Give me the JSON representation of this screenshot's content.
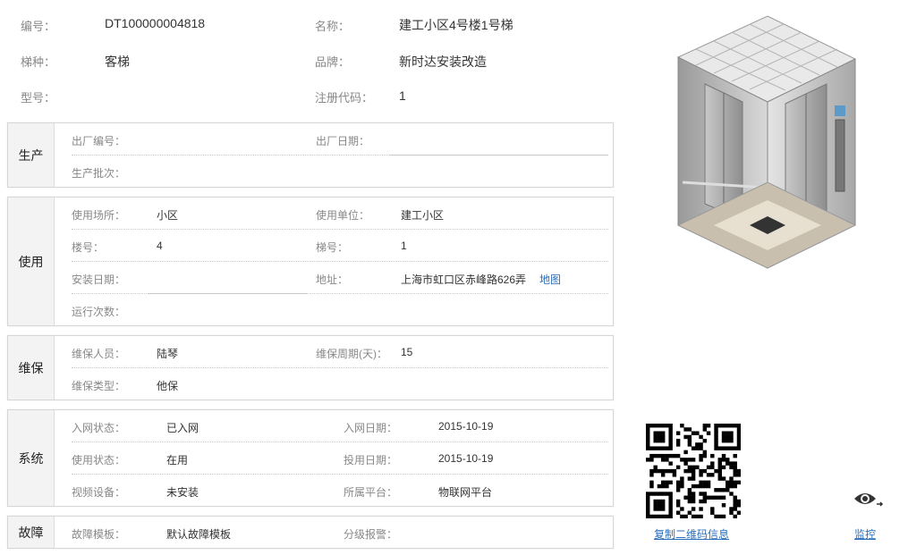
{
  "info": {
    "code_label": "编号：",
    "code_value": "DT100000004818",
    "name_label": "名称：",
    "name_value": "建工小区4号楼1号梯",
    "type_label": "梯种：",
    "type_value": "客梯",
    "brand_label": "品牌：",
    "brand_value": "新时达安装改造",
    "model_label": "型号：",
    "model_value": "",
    "reg_label": "注册代码：",
    "reg_value": "1"
  },
  "production": {
    "title": "生产",
    "factory_no_label": "出厂编号：",
    "factory_no_value": "",
    "factory_date_label": "出厂日期：",
    "factory_date_value": "",
    "batch_label": "生产批次：",
    "batch_value": ""
  },
  "usage": {
    "title": "使用",
    "place_label": "使用场所：",
    "place_value": "小区",
    "unit_label": "使用单位：",
    "unit_value": "建工小区",
    "building_label": "楼号：",
    "building_value": "4",
    "elevator_no_label": "梯号：",
    "elevator_no_value": "1",
    "install_date_label": "安装日期：",
    "install_date_value": "",
    "address_label": "地址：",
    "address_value": "上海市虹口区赤峰路626弄",
    "map_link": "地图",
    "run_count_label": "运行次数：",
    "run_count_value": ""
  },
  "maintenance": {
    "title": "维保",
    "staff_label": "维保人员：",
    "staff_value": "陆琴",
    "period_label": "维保周期(天)：",
    "period_value": "15",
    "mtype_label": "维保类型：",
    "mtype_value": "他保"
  },
  "system": {
    "title": "系统",
    "net_status_label": "入网状态：",
    "net_status_value": "已入网",
    "net_date_label": "入网日期：",
    "net_date_value": "2015-10-19",
    "use_status_label": "使用状态：",
    "use_status_value": "在用",
    "use_date_label": "投用日期：",
    "use_date_value": "2015-10-19",
    "video_label": "视频设备：",
    "video_value": "未安装",
    "platform_label": "所属平台：",
    "platform_value": "物联网平台"
  },
  "fault": {
    "title": "故障",
    "template_label": "故障模板：",
    "template_value": "默认故障模板",
    "alarm_label": "分级报警：",
    "alarm_value": ""
  },
  "actions": {
    "copy_qr": "复制二维码信息",
    "monitor": "监控"
  },
  "icons": {
    "monitor": "eye-icon",
    "qr": "qr-code"
  },
  "colors": {
    "link": "#2a6ebb",
    "section_title_bg": "#f3f3f3"
  }
}
